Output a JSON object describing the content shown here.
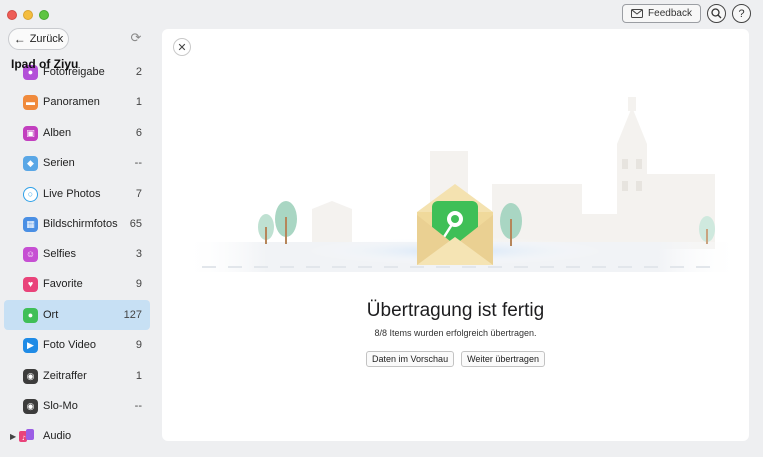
{
  "toolbar": {
    "back_label": "Zurück",
    "feedback_label": "Feedback"
  },
  "sidebar": {
    "device_name": "Ipad of Ziyu",
    "items": [
      {
        "label": "Fotofreigabe",
        "count": "2",
        "icon": "shared-photos-icon",
        "color": "#b34fd8"
      },
      {
        "label": "Panoramen",
        "count": "1",
        "icon": "panorama-icon",
        "color": "#f08a3c"
      },
      {
        "label": "Alben",
        "count": "6",
        "icon": "album-icon",
        "color": "#c23fbf"
      },
      {
        "label": "Serien",
        "count": "--",
        "icon": "burst-icon",
        "color": "#5aa7e6"
      },
      {
        "label": "Live Photos",
        "count": "7",
        "icon": "live-photo-icon",
        "color": "#2ea0e8"
      },
      {
        "label": "Bildschirmfotos",
        "count": "65",
        "icon": "screenshot-icon",
        "color": "#4a8fe4"
      },
      {
        "label": "Selfies",
        "count": "3",
        "icon": "selfie-icon",
        "color": "#c64fd3"
      },
      {
        "label": "Favorite",
        "count": "9",
        "icon": "heart-icon",
        "color": "#e9437a"
      },
      {
        "label": "Ort",
        "count": "127",
        "icon": "location-pin-icon",
        "color": "#3fbf57"
      },
      {
        "label": "Foto Video",
        "count": "9",
        "icon": "video-camera-icon",
        "color": "#1f8be6"
      },
      {
        "label": "Zeitraffer",
        "count": "1",
        "icon": "timelapse-camera-icon",
        "color": "#3c3c3c"
      },
      {
        "label": "Slo-Mo",
        "count": "--",
        "icon": "slowmo-camera-icon",
        "color": "#3c3c3c"
      }
    ],
    "audio_label": "Audio"
  },
  "main": {
    "title": "Übertragung ist fertig",
    "subtitle": "8/8 Items wurden erfolgreich übertragen.",
    "preview_button": "Daten im Vorschau",
    "continue_button": "Weiter übertragen"
  },
  "colors": {
    "active_row": "#c7e0f4",
    "envelope": "#f1dca1",
    "pin_green": "#3fbf57"
  }
}
